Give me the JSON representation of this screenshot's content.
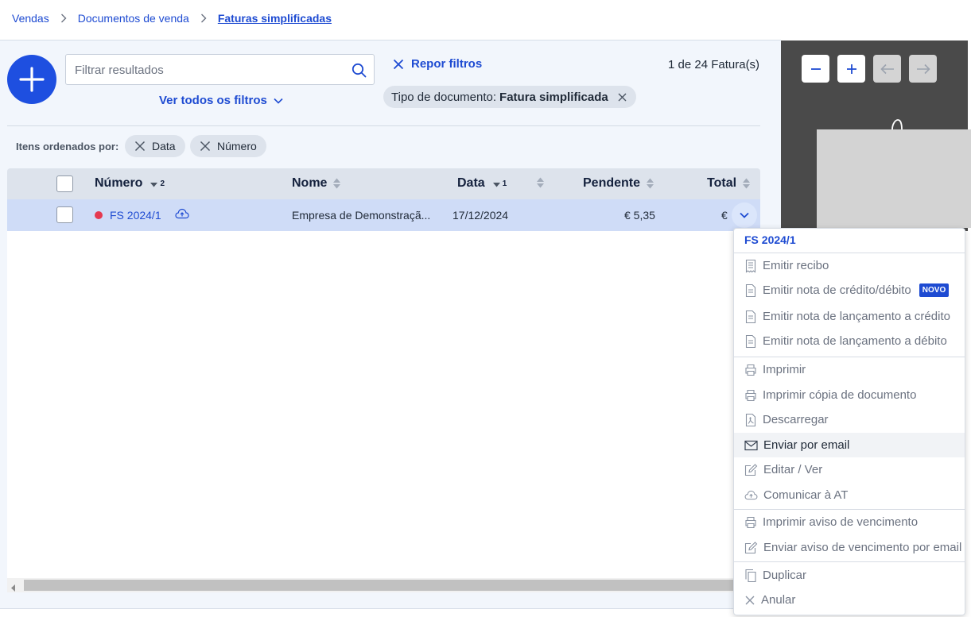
{
  "breadcrumb": {
    "items": [
      "Vendas",
      "Documentos de venda"
    ],
    "current": "Faturas simplificadas"
  },
  "toolbar": {
    "search_placeholder": "Filtrar resultados",
    "all_filters": "Ver todos os filtros",
    "reset_filters": "Repor filtros",
    "result_count": "1 de 24 Fatura(s)"
  },
  "active_filter": {
    "label": "Tipo de documento:",
    "value": "Fatura simplificada"
  },
  "sorting": {
    "label": "Itens ordenados por:",
    "chips": [
      "Data",
      "Número"
    ]
  },
  "table": {
    "columns": {
      "numero": "Número",
      "numero_order": "2",
      "nome": "Nome",
      "data": "Data",
      "data_order": "1",
      "pendente": "Pendente",
      "total": "Total"
    },
    "rows": [
      {
        "numero": "FS 2024/1",
        "nome": "Empresa de Demonstraçã...",
        "data": "17/12/2024",
        "pendente": "€ 5,35",
        "total": "€"
      }
    ]
  },
  "menu": {
    "title": "FS 2024/1",
    "new_badge": "NOVO",
    "items": [
      "Emitir recibo",
      "Emitir nota de crédito/débito",
      "Emitir nota de lançamento a crédito",
      "Emitir nota de lançamento a débito",
      "Imprimir",
      "Imprimir cópia de documento",
      "Descarregar",
      "Enviar por email",
      "Editar / Ver",
      "Comunicar à AT",
      "Imprimir aviso de vencimento",
      "Enviar aviso de vencimento por email",
      "Duplicar",
      "Anular"
    ],
    "highlighted": "Enviar por email"
  },
  "colors": {
    "accent": "#1e4bd2",
    "fab": "#1e4fe0",
    "status_dot": "#e53950",
    "selected_row": "#cfdcf7",
    "preview_bg": "#4a4a4a"
  }
}
